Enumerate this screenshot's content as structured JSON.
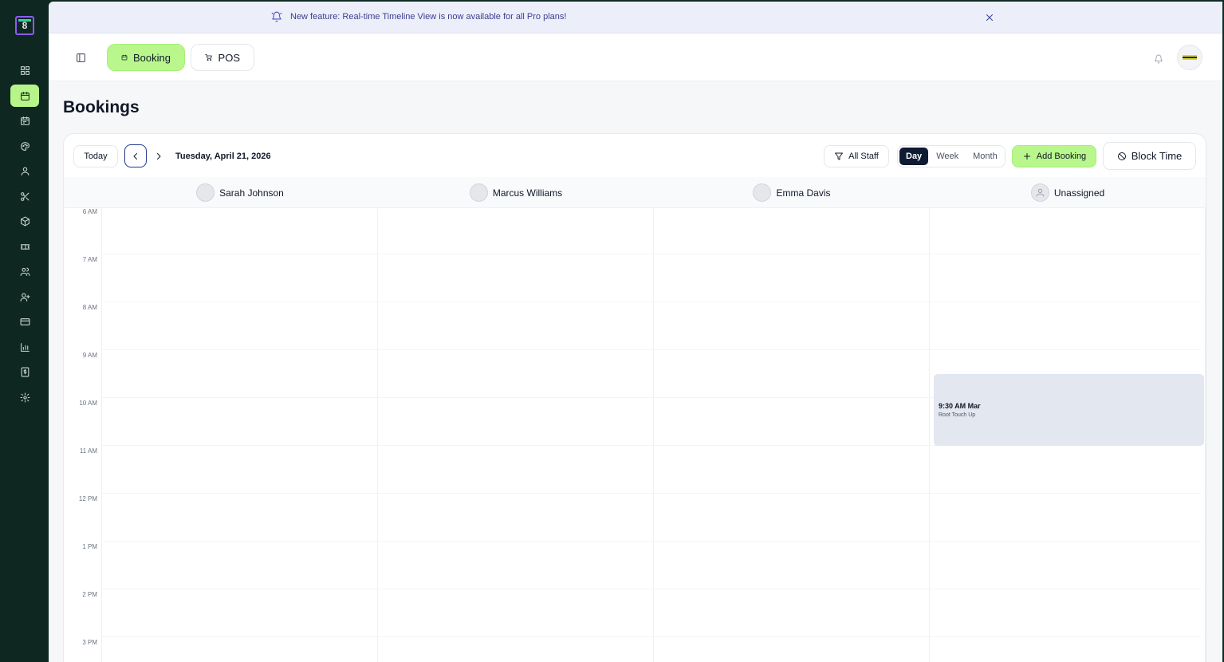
{
  "rail": {
    "logo": "8",
    "items": [
      {
        "name": "dashboard",
        "active": false
      },
      {
        "name": "bookings",
        "active": true
      },
      {
        "name": "calendar",
        "active": false
      },
      {
        "name": "palette",
        "active": false
      },
      {
        "name": "profile",
        "active": false
      },
      {
        "name": "services",
        "active": false
      },
      {
        "name": "products",
        "active": false
      },
      {
        "name": "tickets",
        "active": false
      },
      {
        "name": "customers",
        "active": false
      },
      {
        "name": "staff",
        "active": false
      },
      {
        "name": "payments",
        "active": false
      },
      {
        "name": "reports",
        "active": false
      },
      {
        "name": "invoices",
        "active": false
      },
      {
        "name": "settings",
        "active": false
      }
    ]
  },
  "announcement": {
    "text": "New feature: Real-time Timeline View is now available for all Pro plans!"
  },
  "topbar": {
    "booking_label": "Booking",
    "pos_label": "POS"
  },
  "page": {
    "title": "Bookings"
  },
  "toolbar": {
    "today_label": "Today",
    "date": "Tuesday, April 21, 2026",
    "staff_filter": "All Staff",
    "views": [
      "Day",
      "Week",
      "Month"
    ],
    "active_view": "Day",
    "add_booking": "Add Booking",
    "block_time": "Block Time"
  },
  "columns": [
    {
      "name": "Sarah Johnson"
    },
    {
      "name": "Marcus Williams"
    },
    {
      "name": "Emma Davis"
    },
    {
      "name": "Unassigned"
    }
  ],
  "hours": [
    "6 AM",
    "7 AM",
    "8 AM",
    "9 AM",
    "10 AM",
    "11 AM",
    "12 PM",
    "1 PM",
    "2 PM",
    "3 PM"
  ],
  "bookings": [
    {
      "column": "Unassigned",
      "time_title": "9:30 AM Mar",
      "service": "Root Touch Up"
    }
  ],
  "colors": {
    "accent": "#b9f78d",
    "rail": "#0e2821",
    "active_view": "#0f1b33",
    "booking_block": "#e2e7f0"
  }
}
